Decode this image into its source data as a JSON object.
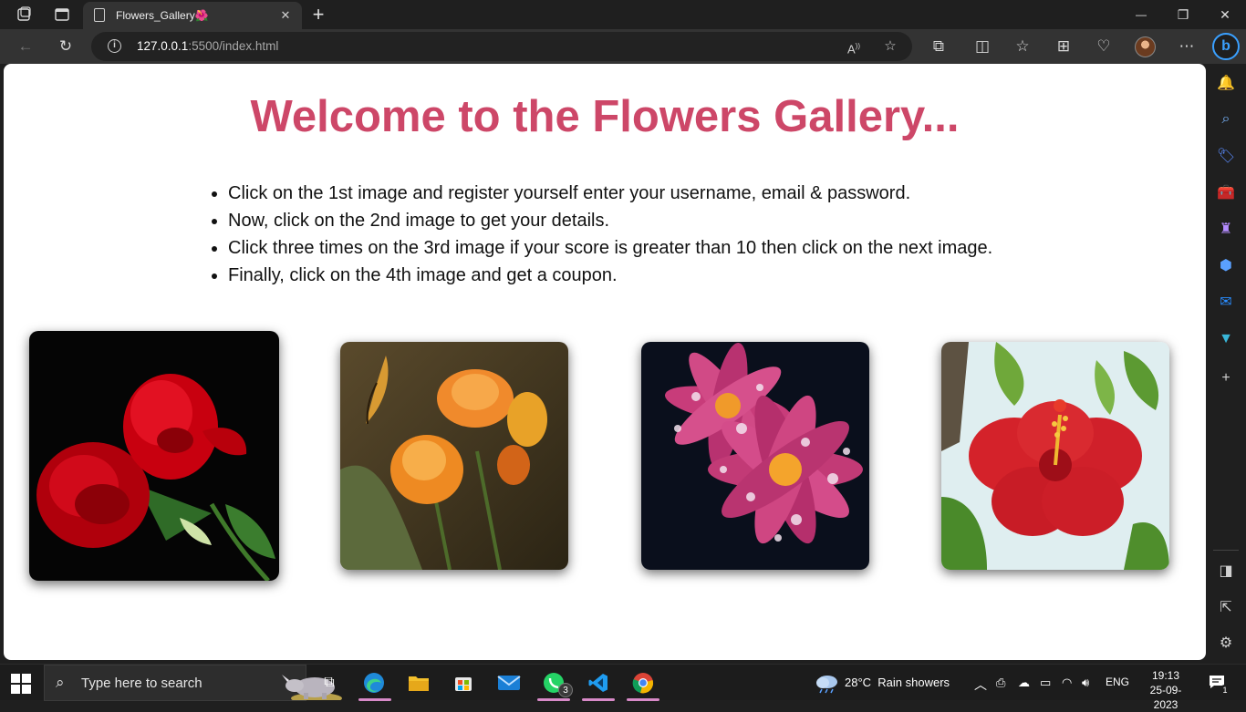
{
  "browser": {
    "tab": {
      "title": "Flowers_Gallery",
      "title_emoji": "🌺",
      "close": "✕"
    },
    "newtab": "+",
    "url": {
      "host": "127.0.0.1",
      "path": ":5500/index.html"
    },
    "window_controls": {
      "minimize": "—",
      "maximize": "❐",
      "close": "✕"
    }
  },
  "page": {
    "title": "Welcome to the Flowers Gallery...",
    "instructions": [
      "Click on the 1st image and register yourself enter your username, email & password.",
      "Now, click on the 2nd image to get your details.",
      "Click three times on the 3rd image if your score is greater than 10 then click on the next image.",
      "Finally, click on the 4th image and get a coupon."
    ],
    "images": [
      {
        "subject": "red roses on black background"
      },
      {
        "subject": "orange flowers with butterfly"
      },
      {
        "subject": "pink flowers with water droplets"
      },
      {
        "subject": "red hibiscus flower"
      }
    ],
    "title_color": "#cd4768"
  },
  "taskbar": {
    "search_placeholder": "Type here to search",
    "weather": {
      "temp": "28°C",
      "condition": "Rain showers"
    },
    "language": "ENG",
    "time": "19:13",
    "date": "25-09-2023",
    "whatsapp_badge": "3",
    "notification_badge": "1"
  }
}
